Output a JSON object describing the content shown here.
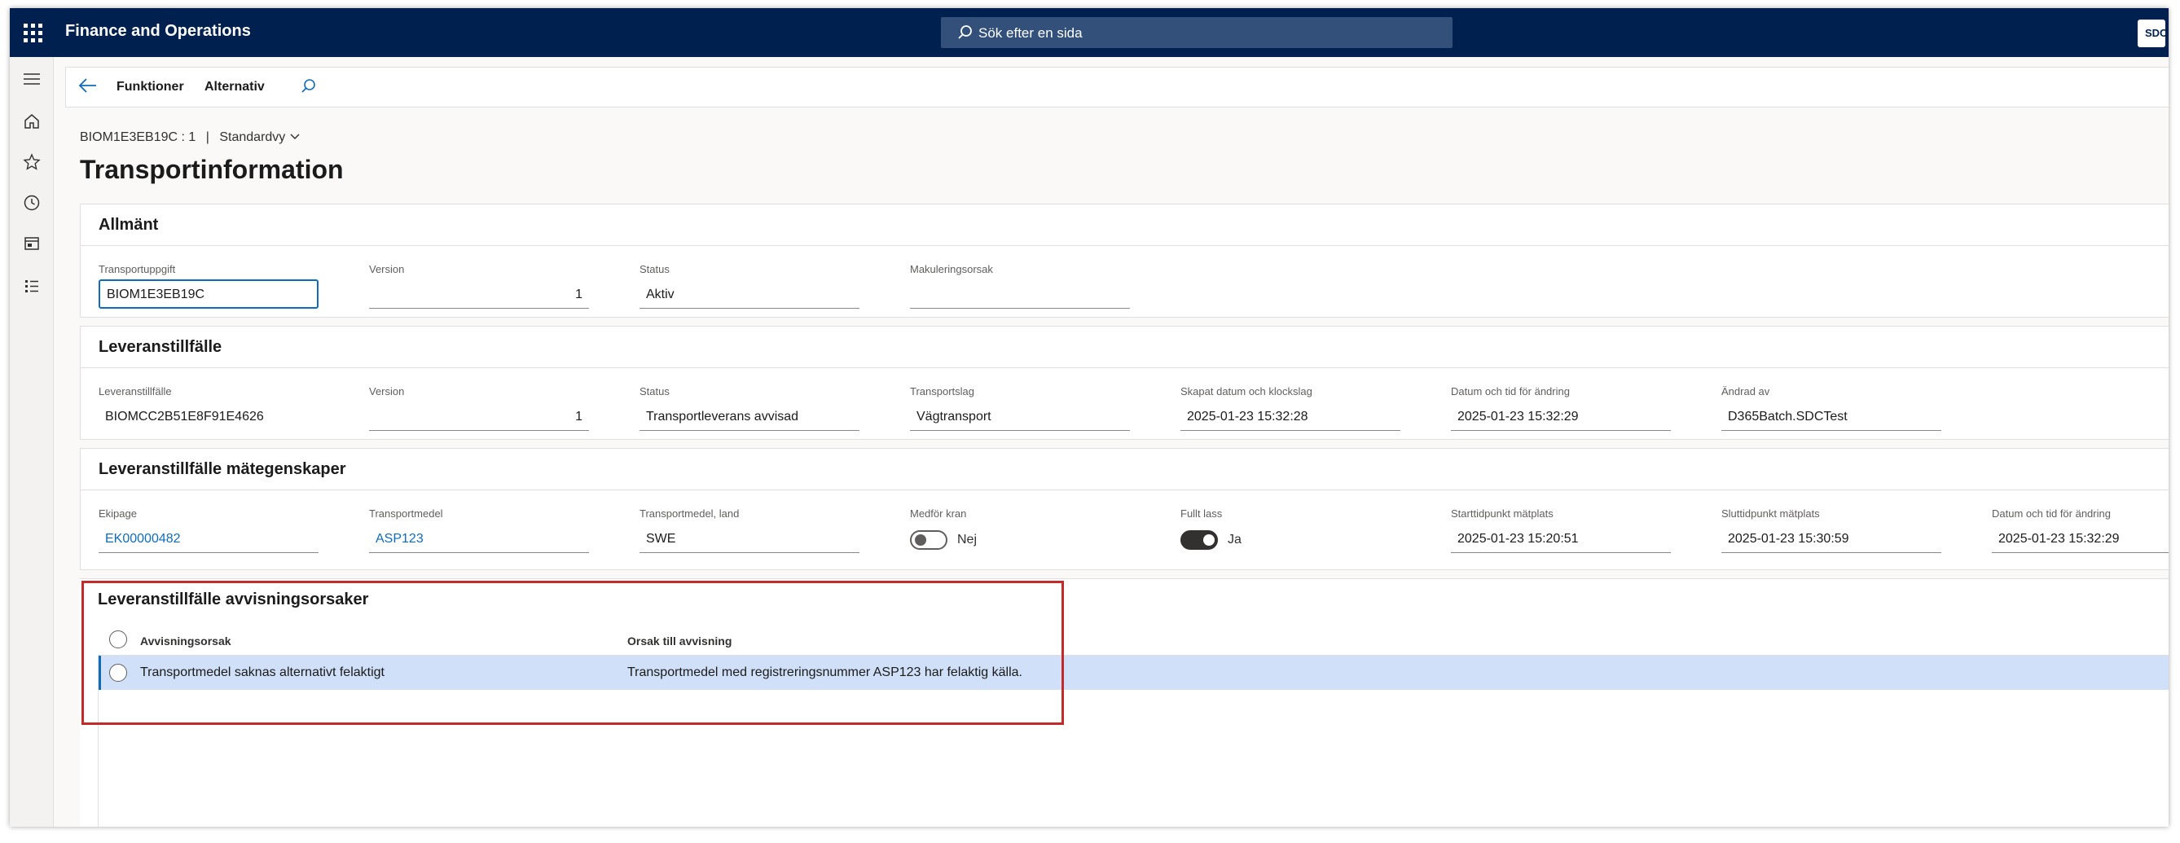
{
  "app": {
    "title": "Finance and Operations",
    "search_placeholder": "Sök efter en sida",
    "user_initials": "SDC"
  },
  "leftnav": {
    "icons": [
      "hamburger-icon",
      "home-icon",
      "star-icon",
      "clock-icon",
      "workspace-icon",
      "list-icon"
    ]
  },
  "actionbar": {
    "items": [
      "Funktioner",
      "Alternativ"
    ]
  },
  "breadcrumb": {
    "record": "BIOM1E3EB19C : 1",
    "separator": "|",
    "view": "Standardvy"
  },
  "page_title": "Transportinformation",
  "sections": {
    "general": {
      "title": "Allmänt",
      "fields": [
        {
          "label": "Transportuppgift",
          "value": "BIOM1E3EB19C"
        },
        {
          "label": "Version",
          "value": "1"
        },
        {
          "label": "Status",
          "value": "Aktiv"
        },
        {
          "label": "Makuleringsorsak",
          "value": ""
        }
      ]
    },
    "delivery": {
      "title": "Leveranstillfälle",
      "fields": [
        {
          "label": "Leveranstillfälle",
          "value": "BIOMCC2B51E8F91E4626"
        },
        {
          "label": "Version",
          "value": "1"
        },
        {
          "label": "Status",
          "value": "Transportleverans avvisad"
        },
        {
          "label": "Transportslag",
          "value": "Vägtransport"
        },
        {
          "label": "Skapat datum och klockslag",
          "value": "2025-01-23 15:32:28"
        },
        {
          "label": "Datum och tid för ändring",
          "value": "2025-01-23 15:32:29"
        },
        {
          "label": "Ändrad av",
          "value": "D365Batch.SDCTest"
        }
      ]
    },
    "measurement": {
      "title": "Leveranstillfälle mätegenskaper",
      "fields": [
        {
          "label": "Ekipage",
          "value": "EK00000482"
        },
        {
          "label": "Transportmedel",
          "value": "ASP123"
        },
        {
          "label": "Transportmedel, land",
          "value": "SWE"
        },
        {
          "label": "Medför kran",
          "value": "Nej"
        },
        {
          "label": "Fullt lass",
          "value": "Ja"
        },
        {
          "label": "Starttidpunkt mätplats",
          "value": "2025-01-23 15:20:51"
        },
        {
          "label": "Sluttidpunkt mätplats",
          "value": "2025-01-23 15:30:59"
        },
        {
          "label": "Datum och tid för ändring",
          "value": "2025-01-23 15:32:29"
        }
      ]
    },
    "rejection": {
      "title": "Leveranstillfälle avvisningsorsaker",
      "columns": [
        "Avvisningsorsak",
        "Orsak till avvisning"
      ],
      "rows": [
        [
          "Transportmedel saknas alternativt felaktigt",
          "Transportmedel med registreringsnummer ASP123 har felaktig källa."
        ]
      ]
    }
  },
  "colors": {
    "topbar": "#002050",
    "accent": "#0f6cbd",
    "selected_row": "#cfe0f8",
    "highlight_box": "#c52a2a"
  }
}
